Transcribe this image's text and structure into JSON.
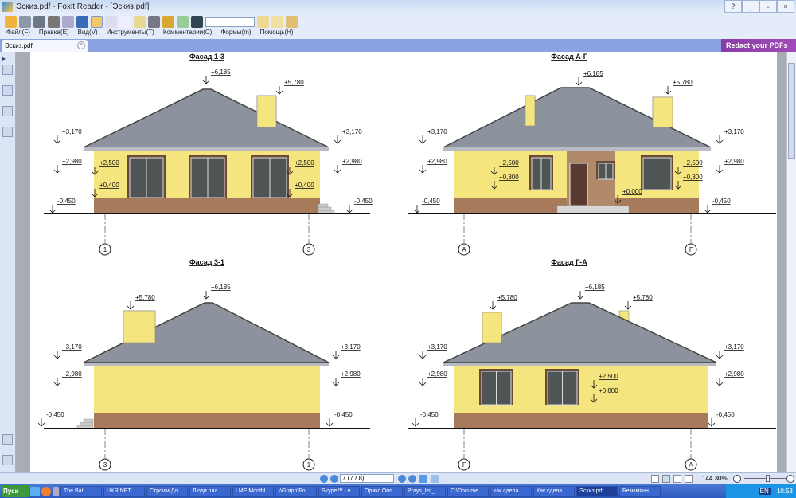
{
  "window": {
    "title": "Эскиз.pdf - Foxit Reader - [Эскиз.pdf]"
  },
  "menu": [
    "Файл(F)",
    "Правка(E)",
    "Вид(V)",
    "Инструменты(T)",
    "Комментарии(C)",
    "Формы(m)",
    "Помощь(H)"
  ],
  "tab": {
    "label": "Эскиз.pdf"
  },
  "ad": {
    "label": "Redact your PDFs"
  },
  "status": {
    "page": "7 (7 / 8)",
    "zoom": "144.30%"
  },
  "taskbar": {
    "start": "Пуск",
    "items": [
      "The Bat!",
      "UKR.NET: ...",
      "Строим До...",
      "Люди пла...",
      "LME Monthl...",
      "\\\\Graph\\Fo...",
      "Skype™ - e...",
      "Орикс Опп...",
      "Prays_list_...",
      "C:\\Docume...",
      "как сдела...",
      "Как сдела...",
      "Эскиз.pdf ...",
      "Безымянн..."
    ],
    "lang": "EN",
    "clock": "10:53"
  },
  "colors": {
    "roof": "#8c939c",
    "wall": "#f5e57e",
    "plinth": "#a87a5c",
    "window": "#4f5555",
    "frame": "#6b4a38"
  },
  "facades": [
    {
      "title": "Фасад 1-3",
      "axes": [
        "1",
        "3"
      ],
      "ridge": "+6,185",
      "chimney": [
        "+5,780"
      ],
      "left": [
        "+3,170",
        "+2,980",
        "-0,450"
      ],
      "right": [
        "+3,170",
        "+2,980",
        "-0,450"
      ],
      "win_left": [
        "+2,500",
        "+0,400"
      ],
      "win_right": [
        "+2,500",
        "+0,400"
      ]
    },
    {
      "title": "Фасад А-Г",
      "axes": [
        "А",
        "Г"
      ],
      "ridge": "+6,185",
      "chimney": [
        "+5,780"
      ],
      "left": [
        "+3,170",
        "+2,980",
        "-0,450"
      ],
      "right": [
        "+3,170",
        "+2,980",
        "-0,450"
      ],
      "win_left": [
        "+2,500",
        "+0,800"
      ],
      "win_right": [
        "+2,500",
        "+0,800"
      ],
      "entrance": "+0,000"
    },
    {
      "title": "Фасад 3-1",
      "axes": [
        "3",
        "1"
      ],
      "ridge": "+6,185",
      "chimney": [
        "+5,780"
      ],
      "left": [
        "+3,170",
        "+2,980",
        "-0,450"
      ],
      "right": [
        "+3,170",
        "+2,980",
        "-0,450"
      ]
    },
    {
      "title": "Фасад Г-А",
      "axes": [
        "Г",
        "А"
      ],
      "ridge": "+6,185",
      "chimney": [
        "+5,780",
        "+5,780"
      ],
      "left": [
        "+3,170",
        "+2,980",
        "-0,450"
      ],
      "right": [
        "+3,170",
        "+2,980",
        "-0,450"
      ],
      "win_left": [
        "+2,500",
        "+0,800"
      ]
    }
  ]
}
